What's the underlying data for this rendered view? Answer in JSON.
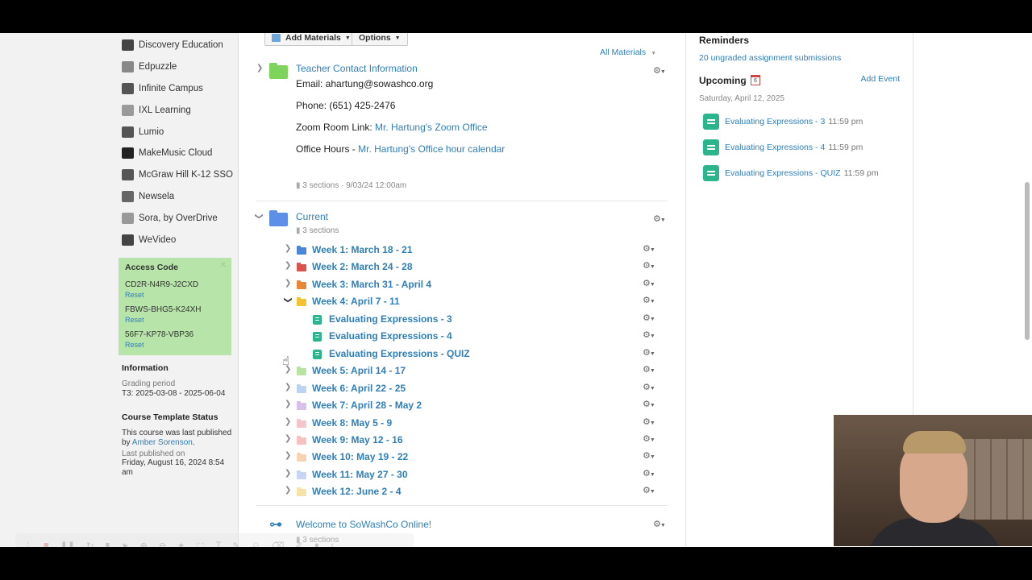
{
  "sidebar": {
    "apps": [
      {
        "label": "Discovery Education",
        "icon": "discovery-education-icon",
        "color": "#444444"
      },
      {
        "label": "Edpuzzle",
        "icon": "edpuzzle-icon",
        "color": "#888888"
      },
      {
        "label": "Infinite Campus",
        "icon": "infinite-campus-icon",
        "color": "#555555"
      },
      {
        "label": "IXL Learning",
        "icon": "ixl-icon",
        "color": "#9a9a9a"
      },
      {
        "label": "Lumio",
        "icon": "lumio-icon",
        "color": "#555555"
      },
      {
        "label": "MakeMusic Cloud",
        "icon": "makemusic-icon",
        "color": "#222222"
      },
      {
        "label": "McGraw Hill K-12 SSO",
        "icon": "mcgraw-hill-icon",
        "color": "#555555"
      },
      {
        "label": "Newsela",
        "icon": "newsela-icon",
        "color": "#666666"
      },
      {
        "label": "Sora, by OverDrive",
        "icon": "sora-icon",
        "color": "#999999"
      },
      {
        "label": "WeVideo",
        "icon": "wevideo-icon",
        "color": "#444444"
      }
    ],
    "access_code": {
      "title": "Access Code",
      "codes": [
        {
          "code": "CD2R-N4R9-J2CXD",
          "reset": "Reset"
        },
        {
          "code": "FBWS-BHG5-K24XH",
          "reset": "Reset"
        },
        {
          "code": "56F7-KP78-VBP36",
          "reset": "Reset"
        }
      ]
    },
    "information": {
      "title": "Information",
      "grading_label": "Grading period",
      "grading_value": "T3: 2025-03-08 - 2025-06-04"
    },
    "template_status": {
      "title": "Course Template Status",
      "text": "This course was last published by",
      "author": "Amber Sorenson",
      "period": ".",
      "last_label": "Last published on",
      "last_value": "Friday, August 16, 2024 8:54 am"
    }
  },
  "toolbar": {
    "add_materials": "Add Materials",
    "options": "Options",
    "all_materials": "All Materials"
  },
  "contact": {
    "title": "Teacher Contact Information",
    "email": "Email: ahartung@sowashco.org",
    "phone": "Phone: (651) 425-2476",
    "zoom_label": "Zoom Room Link: ",
    "zoom_link": "Mr. Hartung's Zoom Office",
    "hours_label": "Office Hours - ",
    "hours_link": "Mr. Hartung's Office hour calendar",
    "meta": "3 sections · 9/03/24 12:00am"
  },
  "current": {
    "title": "Current",
    "meta": "3 sections",
    "weeks": [
      {
        "label": "Week 1: March 18 - 21",
        "color": "#4a86d8"
      },
      {
        "label": "Week 2: March 24 - 28",
        "color": "#d9534f"
      },
      {
        "label": "Week 3: March 31 - April 4",
        "color": "#e8873a"
      },
      {
        "label": "Week 4: April 7 - 11",
        "color": "#f2c230"
      }
    ],
    "assignments": [
      {
        "label": "Evaluating Expressions - 3"
      },
      {
        "label": "Evaluating Expressions - 4"
      },
      {
        "label": "Evaluating Expressions - QUIZ"
      }
    ],
    "later_weeks": [
      {
        "label": "Week 5: April 14 - 17",
        "color": "#b9e3a3"
      },
      {
        "label": "Week 6: April 22 - 25",
        "color": "#bcd3f2"
      },
      {
        "label": "Week 7: April 28 - May 2",
        "color": "#d9c0ea"
      },
      {
        "label": "Week 8: May 5 - 9",
        "color": "#f4c5cf"
      },
      {
        "label": "Week 9: May 12 - 16",
        "color": "#f5c2bf"
      },
      {
        "label": "Week 10: May 19 - 22",
        "color": "#f6d4b3"
      },
      {
        "label": "Week 11: May 27 - 30",
        "color": "#c6d6f4"
      },
      {
        "label": "Week 12: June 2 - 4",
        "color": "#f7e3a8"
      }
    ]
  },
  "welcome": {
    "title": "Welcome to SoWashCo Online!",
    "meta": "3 sections"
  },
  "reminders": {
    "title": "Reminders",
    "link": "20 ungraded assignment submissions"
  },
  "upcoming": {
    "title": "Upcoming",
    "calendar_day": "6",
    "add_event": "Add Event",
    "date": "Saturday, April 12, 2025",
    "items": [
      {
        "label": "Evaluating Expressions - 3",
        "time": "11:59 pm"
      },
      {
        "label": "Evaluating Expressions - 4",
        "time": "11:59 pm"
      },
      {
        "label": "Evaluating Expressions - QUIZ",
        "time": "11:59 pm"
      }
    ]
  }
}
